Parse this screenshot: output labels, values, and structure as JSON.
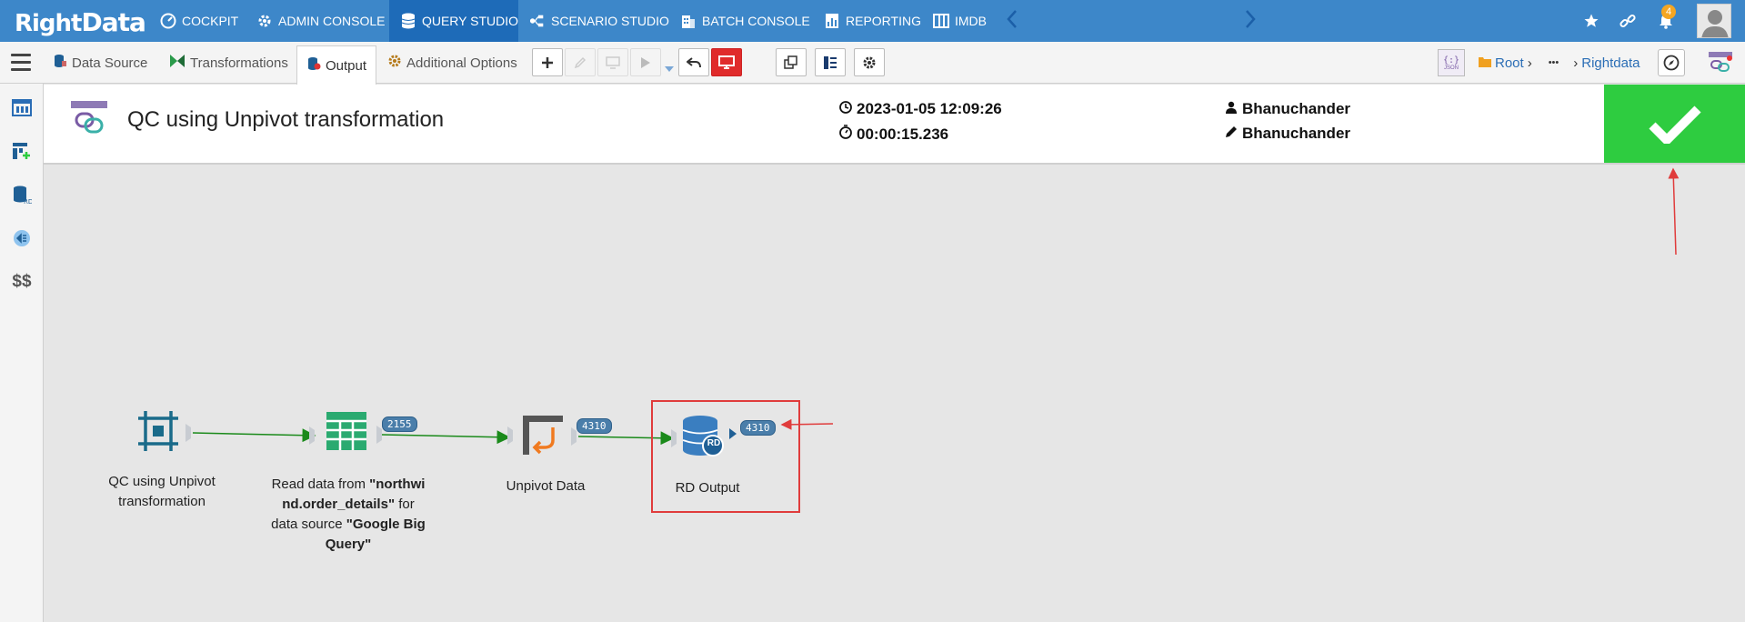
{
  "app": {
    "logo_part1": "Right",
    "logo_part2": "Data"
  },
  "topnav": {
    "items": [
      {
        "label": "COCKPIT",
        "icon": "gauge-icon"
      },
      {
        "label": "ADMIN CONSOLE",
        "icon": "gear-icon"
      },
      {
        "label": "QUERY STUDIO",
        "icon": "database-icon",
        "active": true
      },
      {
        "label": "SCENARIO STUDIO",
        "icon": "flow-icon"
      },
      {
        "label": "BATCH CONSOLE",
        "icon": "building-icon"
      },
      {
        "label": "REPORTING",
        "icon": "report-icon"
      },
      {
        "label": "IMDB",
        "icon": "columns-icon"
      }
    ],
    "notifications_count": "4"
  },
  "toolbar": {
    "tabs": [
      {
        "label": "Data Source"
      },
      {
        "label": "Transformations"
      },
      {
        "label": "Output",
        "active": true
      },
      {
        "label": "Additional Options"
      }
    ],
    "json_label": "JSON",
    "breadcrumb": {
      "root": "Root",
      "ellipsis": "•••",
      "current": "Rightdata"
    }
  },
  "sidebar": {
    "currency_label": "$$"
  },
  "header": {
    "title": "QC using Unpivot transformation",
    "run_datetime": "2023-01-05 12:09:26",
    "duration": "00:00:15.236",
    "created_by": "Bhanuchander",
    "modified_by": "Bhanuchander",
    "status": "success"
  },
  "pipeline": {
    "nodes": [
      {
        "id": "source",
        "label": "QC using Unpivot transformation"
      },
      {
        "id": "read",
        "label_html_parts": [
          "Read data from ",
          "\"northwind.order_details\"",
          " for data source ",
          "\"Google Big Query\""
        ]
      },
      {
        "id": "unpivot",
        "label": "Unpivot Data"
      },
      {
        "id": "output",
        "label": "RD Output",
        "badge_text": "RD"
      }
    ],
    "counts": {
      "read": "2155",
      "unpivot": "4310",
      "output": "4310"
    }
  },
  "colors": {
    "nav_bg": "#3d87c9",
    "nav_active": "#1e6bb8",
    "success": "#2ecc40",
    "edge": "#1a8a1a",
    "annotation": "#e03c3c"
  }
}
